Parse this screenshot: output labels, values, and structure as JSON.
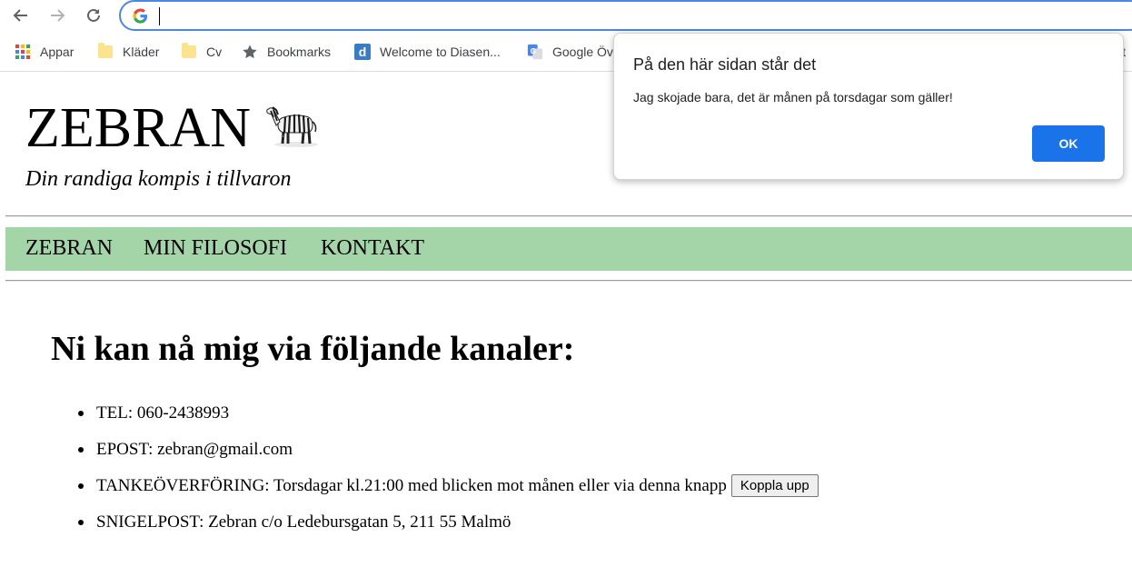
{
  "browser": {
    "back_icon": "arrow-left-icon",
    "forward_icon": "arrow-right-icon",
    "reload_icon": "reload-icon",
    "omnibox_value": "",
    "bookmarks": [
      {
        "label": "Appar",
        "icon": "apps-grid-icon"
      },
      {
        "label": "Kläder",
        "icon": "folder-icon"
      },
      {
        "label": "Cv",
        "icon": "folder-icon"
      },
      {
        "label": "Bookmarks",
        "icon": "star-icon"
      },
      {
        "label": "Welcome to Diasen...",
        "icon": "diasen-icon"
      },
      {
        "label": "Google Öv",
        "icon": "google-translate-icon"
      }
    ],
    "bookmarks_overflow_label": "it"
  },
  "site": {
    "title": "ZEBRAN",
    "tagline": "Din randiga kompis i tillvaron",
    "nav": [
      "ZEBRAN",
      "MIN FILOSOFI",
      "KONTAKT"
    ],
    "nav_bg": "#a4d5a8"
  },
  "main": {
    "heading": "Ni kan nå mig via följande kanaler:",
    "items": [
      "TEL: 060-2438993",
      "EPOST: zebran@gmail.com",
      "TANKEÖVERFÖRING: Torsdagar kl.21:00 med blicken mot månen eller via denna knapp",
      "SNIGELPOST: Zebran c/o Ledebursgatan 5, 211 55 Malmö"
    ],
    "connect_button": "Koppla upp"
  },
  "dialog": {
    "title": "På den här sidan står det",
    "message": "Jag skojade bara, det är månen på torsdagar som gäller!",
    "ok_label": "OK",
    "ok_color": "#1a73e8"
  }
}
